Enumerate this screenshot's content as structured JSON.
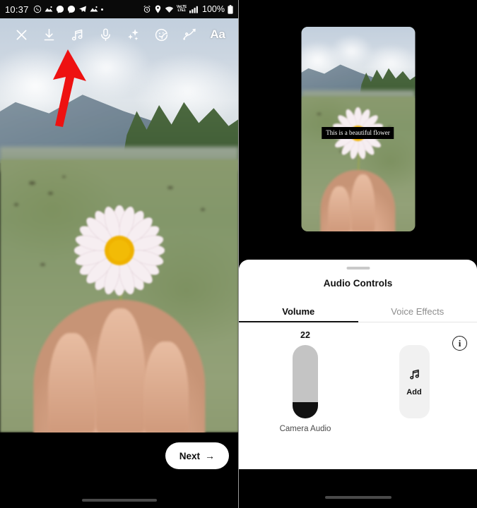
{
  "status_bar": {
    "time": "10:37",
    "left_icons": [
      "whatsapp-icon",
      "photos-icon",
      "messenger-icon",
      "messenger-icon",
      "telegram-icon",
      "photos-icon",
      "more-dot-icon"
    ],
    "right_icons": [
      "alarm-icon",
      "location-icon",
      "wifi-icon",
      "volte-icon",
      "signal-bars-icon"
    ],
    "volte_top": "VoLTE",
    "volte_bottom": "LTE1",
    "battery_percent": "100%"
  },
  "editor_toolbar": {
    "items": [
      {
        "name": "close-icon",
        "label": "Close"
      },
      {
        "name": "download-icon",
        "label": "Save"
      },
      {
        "name": "music-note-icon",
        "label": "Audio"
      },
      {
        "name": "microphone-icon",
        "label": "Voiceover"
      },
      {
        "name": "sparkles-icon",
        "label": "Effects"
      },
      {
        "name": "sticker-icon",
        "label": "Stickers"
      },
      {
        "name": "draw-icon",
        "label": "Draw"
      },
      {
        "name": "text-icon",
        "label": "Aa"
      }
    ],
    "text_label": "Aa"
  },
  "annotation": {
    "arrow_color": "#ee1111",
    "points_to": "music-note-icon"
  },
  "left_screen": {
    "next_button": "Next",
    "next_arrow": "→"
  },
  "preview": {
    "caption_text": "This is a beautiful flower"
  },
  "sheet": {
    "title": "Audio Controls",
    "tabs": [
      {
        "label": "Volume",
        "active": true
      },
      {
        "label": "Voice Effects",
        "active": false
      }
    ],
    "volume": {
      "value": "22",
      "value_number": 22,
      "track_label": "Camera Audio",
      "fill_percent": 22
    },
    "add_button": {
      "label": "Add",
      "icon": "music-note-icon"
    },
    "info_button": {
      "icon": "info-icon",
      "glyph": "i"
    }
  },
  "colors": {
    "accent_black": "#111111",
    "sheet_background": "#ffffff",
    "inactive_tab": "#8d8d8d",
    "slider_track": "#c4c4c4",
    "add_button_bg": "#f1f1f1",
    "annotation_red": "#ee1111"
  }
}
